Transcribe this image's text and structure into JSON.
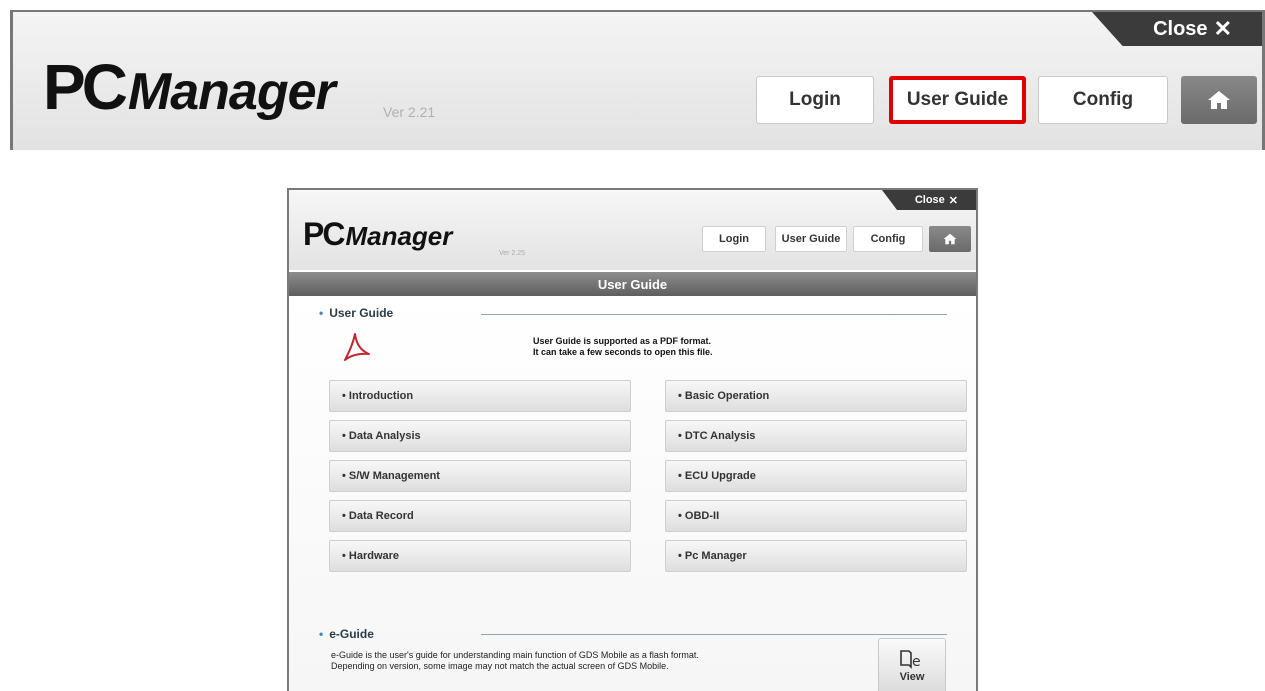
{
  "zoom_header": {
    "logo_pc": "PC",
    "logo_manager": "Manager",
    "version": "Ver 2.21",
    "close_label": "Close",
    "buttons": [
      "Login",
      "User Guide",
      "Config"
    ]
  },
  "window": {
    "logo_pc": "PC",
    "logo_manager": "Manager",
    "version": "Ver 2.25",
    "close_label": "Close",
    "buttons": [
      "Login",
      "User Guide",
      "Config"
    ],
    "title_bar": "User Guide",
    "user_guide": {
      "title": "User Guide",
      "note_line1": "User Guide is supported as a PDF format.",
      "note_line2": "It can take a few seconds to open this file.",
      "items": [
        "• Introduction",
        "• Basic Operation",
        "• Data Analysis",
        "• DTC Analysis",
        "• S/W Management",
        "• ECU Upgrade",
        "• Data Record",
        "• OBD-II",
        "• Hardware",
        "• Pc Manager"
      ]
    },
    "e_guide": {
      "title": "e-Guide",
      "line1": "e-Guide is the user's guide for understanding main function of GDS Mobile as a flash format.",
      "line2": "Depending on version, some image may not match the actual screen of GDS Mobile.",
      "view_label": "View"
    }
  },
  "colors": {
    "highlight": "#e00000",
    "title_bar": "#6e6e6e",
    "section_dot": "#3e8fb8"
  }
}
